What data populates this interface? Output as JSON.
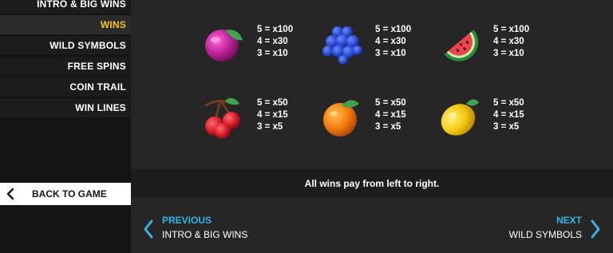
{
  "menu": {
    "items": [
      {
        "label": "INTRO & BIG WINS",
        "active": false
      },
      {
        "label": "WINS",
        "active": true
      },
      {
        "label": "WILD SYMBOLS",
        "active": false
      },
      {
        "label": "FREE SPINS",
        "active": false
      },
      {
        "label": "COIN TRAIL",
        "active": false
      },
      {
        "label": "WIN LINES",
        "active": false
      }
    ],
    "back_label": "BACK TO GAME"
  },
  "symbols": [
    {
      "icon": "plum-icon",
      "pays": [
        "5 = x100",
        "4 = x30",
        "3 = x10"
      ]
    },
    {
      "icon": "blueberries-icon",
      "pays": [
        "5 = x100",
        "4 = x30",
        "3 = x10"
      ]
    },
    {
      "icon": "watermelon-icon",
      "pays": [
        "5 = x100",
        "4 = x30",
        "3 = x10"
      ]
    },
    {
      "icon": "cherries-icon",
      "pays": [
        "5 = x50",
        "4 = x15",
        "3 = x5"
      ]
    },
    {
      "icon": "orange-icon",
      "pays": [
        "5 = x50",
        "4 = x15",
        "3 = x5"
      ]
    },
    {
      "icon": "lemon-icon",
      "pays": [
        "5 = x50",
        "4 = x15",
        "3 = x5"
      ]
    }
  ],
  "info": "All wins pay from left to right.",
  "nav": {
    "prev_title": "PREVIOUS",
    "prev_sub": "INTRO & BIG WINS",
    "next_title": "NEXT",
    "next_sub": "WILD SYMBOLS"
  },
  "colors": {
    "active_menu": "#f5c518",
    "nav_accent": "#35b6e6"
  }
}
